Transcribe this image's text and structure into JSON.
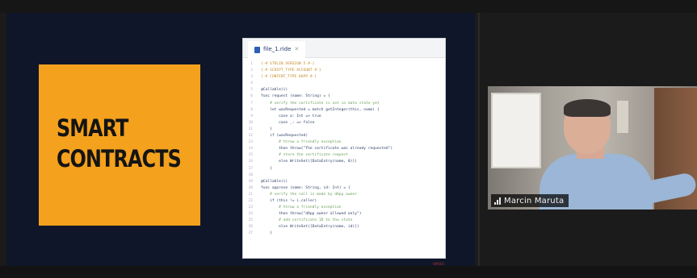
{
  "slide": {
    "title_line1": "SMART",
    "title_line2": "CONTRACTS",
    "watermark": "WAVES"
  },
  "editor": {
    "tab_label": "file_1.ride",
    "close_glyph": "✕",
    "lines": [
      {
        "n": "1",
        "text": "{-# STDLIB_VERSION 5 #-}",
        "kind": "comment"
      },
      {
        "n": "2",
        "text": "{-# SCRIPT_TYPE ACCOUNT #-}",
        "kind": "comment"
      },
      {
        "n": "3",
        "text": "{-# CONTENT_TYPE DAPP #-}",
        "kind": "comment"
      },
      {
        "n": "4",
        "text": "",
        "kind": "code"
      },
      {
        "n": "5",
        "text": "@Callable(i)",
        "kind": "code"
      },
      {
        "n": "6",
        "text": "func request (name: String) = {",
        "kind": "code"
      },
      {
        "n": "7",
        "text": "    # verify the certificate is not in data state yet",
        "kind": "note"
      },
      {
        "n": "8",
        "text": "    let wasRequested = match getInteger(this, name) {",
        "kind": "code"
      },
      {
        "n": "9",
        "text": "        case a: Int => true",
        "kind": "code"
      },
      {
        "n": "10",
        "text": "        case _: => false",
        "kind": "code"
      },
      {
        "n": "11",
        "text": "    }",
        "kind": "code"
      },
      {
        "n": "12",
        "text": "    if (wasRequested)",
        "kind": "code"
      },
      {
        "n": "13",
        "text": "        # throw a friendly exception",
        "kind": "note"
      },
      {
        "n": "14",
        "text": "        then throw(\"The certificate was already requested\")",
        "kind": "code"
      },
      {
        "n": "15",
        "text": "        # store the certificate request",
        "kind": "note"
      },
      {
        "n": "16",
        "text": "        else WriteSet([DataEntry(name, 0)])",
        "kind": "code"
      },
      {
        "n": "17",
        "text": "    }",
        "kind": "code"
      },
      {
        "n": "18",
        "text": "",
        "kind": "code"
      },
      {
        "n": "19",
        "text": "@Callable(i)",
        "kind": "code"
      },
      {
        "n": "20",
        "text": "func approve (name: String, id: Int) = {",
        "kind": "code"
      },
      {
        "n": "21",
        "text": "    # verify the call is made by dApp owner",
        "kind": "note"
      },
      {
        "n": "22",
        "text": "    if (this != i.caller)",
        "kind": "code"
      },
      {
        "n": "23",
        "text": "        # throw a friendly exception",
        "kind": "note"
      },
      {
        "n": "24",
        "text": "        then throw(\"dApp owner allowed only\")",
        "kind": "code"
      },
      {
        "n": "25",
        "text": "        # add certificate ID to the state",
        "kind": "note"
      },
      {
        "n": "26",
        "text": "        else WriteSet([DataEntry(name, id)])",
        "kind": "code"
      },
      {
        "n": "27",
        "text": "    }",
        "kind": "code"
      }
    ]
  },
  "video": {
    "participant_name": "Marcin Maruta",
    "icon": "signal-strength-icon"
  },
  "colors": {
    "slide_bg": "#0f1629",
    "title_box": "#f4a11e",
    "comment": "#c88d2a",
    "note": "#6aa05a",
    "code": "#2c3e66"
  }
}
